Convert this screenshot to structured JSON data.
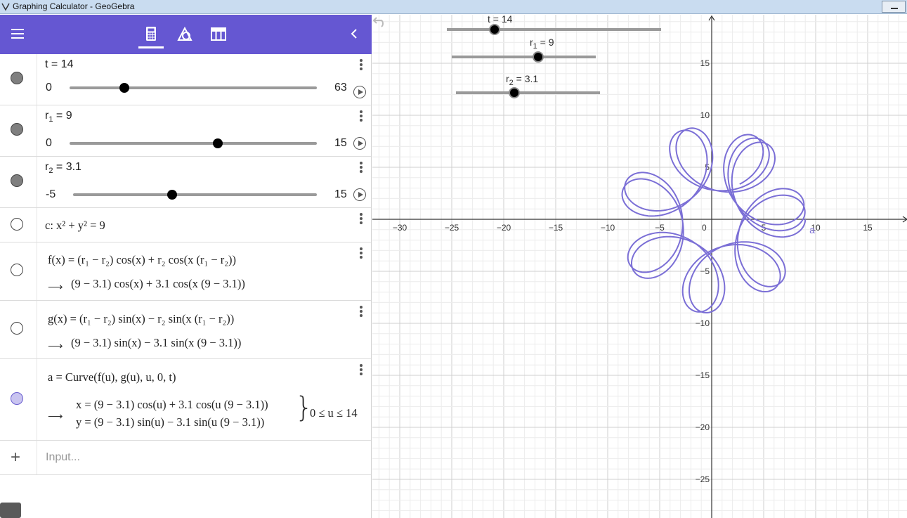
{
  "window": {
    "title": "Graphing Calculator - GeoGebra"
  },
  "toolbar": {
    "icons": [
      "menu-icon",
      "calculator-icon",
      "geometry-icon",
      "table-icon",
      "chevron-left-icon"
    ]
  },
  "algebra": {
    "sliders": [
      {
        "label_main": "t = 14",
        "min": "0",
        "max": "63",
        "value": 14,
        "lo": 0,
        "hi": 63
      },
      {
        "name": "r",
        "subscript": "1",
        "eq": " = 9",
        "min": "0",
        "max": "15",
        "value": 9,
        "lo": 0,
        "hi": 15
      },
      {
        "name": "r",
        "subscript": "2",
        "eq": " = 3.1",
        "min": "-5",
        "max": "15",
        "value": 3.1,
        "lo": -5,
        "hi": 15
      }
    ],
    "circle": {
      "text": "c: x² + y² = 9"
    },
    "f": {
      "def_lhs": "f(x)  =  (r",
      "def_rest": "(r₁ − r₂)  cos(x) + r₂  cos(x (r₁ − r₂))",
      "definition": "f(x)  =  (r₁ − r₂)  cos(x) + r₂  cos(x (r₁ − r₂))",
      "value": "(9 − 3.1)  cos(x) + 3.1  cos(x (9 − 3.1))"
    },
    "g": {
      "definition": "g(x)  =  (r₁ − r₂)  sin(x) − r₂  sin(x (r₁ − r₂))",
      "value": "(9 − 3.1)  sin(x) − 3.1  sin(x (9 − 3.1))"
    },
    "curve": {
      "definition": "a  =  Curve(f(u), g(u), u, 0, t)",
      "x_line": "x = (9 − 3.1)  cos(u) + 3.1  cos(u (9 − 3.1))",
      "y_line": "y = (9 − 3.1)  sin(u) − 3.1  sin(u (9 − 3.1))",
      "condition": "0 ≤ u ≤ 14"
    },
    "input": {
      "placeholder": "Input..."
    }
  },
  "graphics": {
    "sliders": [
      {
        "label": "t = 14"
      },
      {
        "name": "r",
        "subscript": "1",
        "eq": " = 9"
      },
      {
        "name": "r",
        "subscript": "2",
        "eq": " = 3.1"
      }
    ],
    "x_ticks": [
      "−30",
      "−25",
      "−20",
      "−15",
      "−10",
      "−5",
      "0",
      "5",
      "10",
      "15"
    ],
    "y_ticks": [
      "15",
      "10",
      "5",
      "−5",
      "−10",
      "−15",
      "−20",
      "−25"
    ],
    "curve_label": "a",
    "curve_color": "#7b6fd6",
    "accent": "#6557d2"
  }
}
